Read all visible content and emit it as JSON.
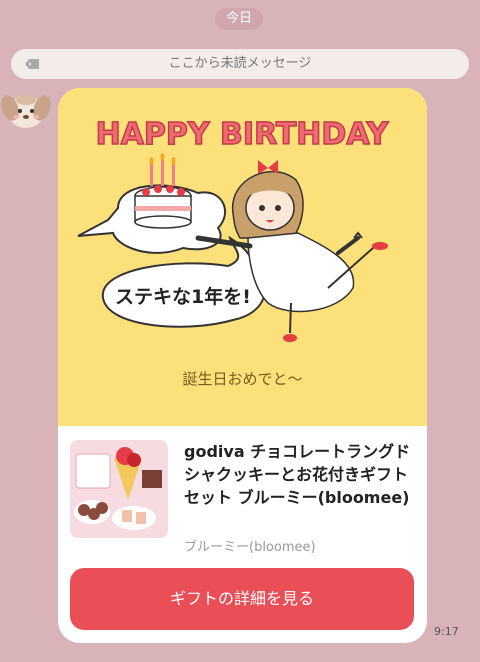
{
  "date_label": "今日",
  "unread_divider": "ここから未読メッセージ",
  "card": {
    "illustration": {
      "headline": "HAPPY BIRTHDAY",
      "speech_bubble": "ステキな1年を!"
    },
    "message": "誕生日おめでと〜",
    "product": {
      "title": "godiva チョコレートラングドシャクッキーとお花付きギフトセット ブルーミー(bloomee)",
      "brand": "ブルーミー(bloomee)"
    },
    "button_label": "ギフトの詳細を見る"
  },
  "timestamp": "9:17",
  "colors": {
    "background": "#d8b3b8",
    "card_illustration_bg": "#fce07a",
    "button": "#ea4f58"
  }
}
